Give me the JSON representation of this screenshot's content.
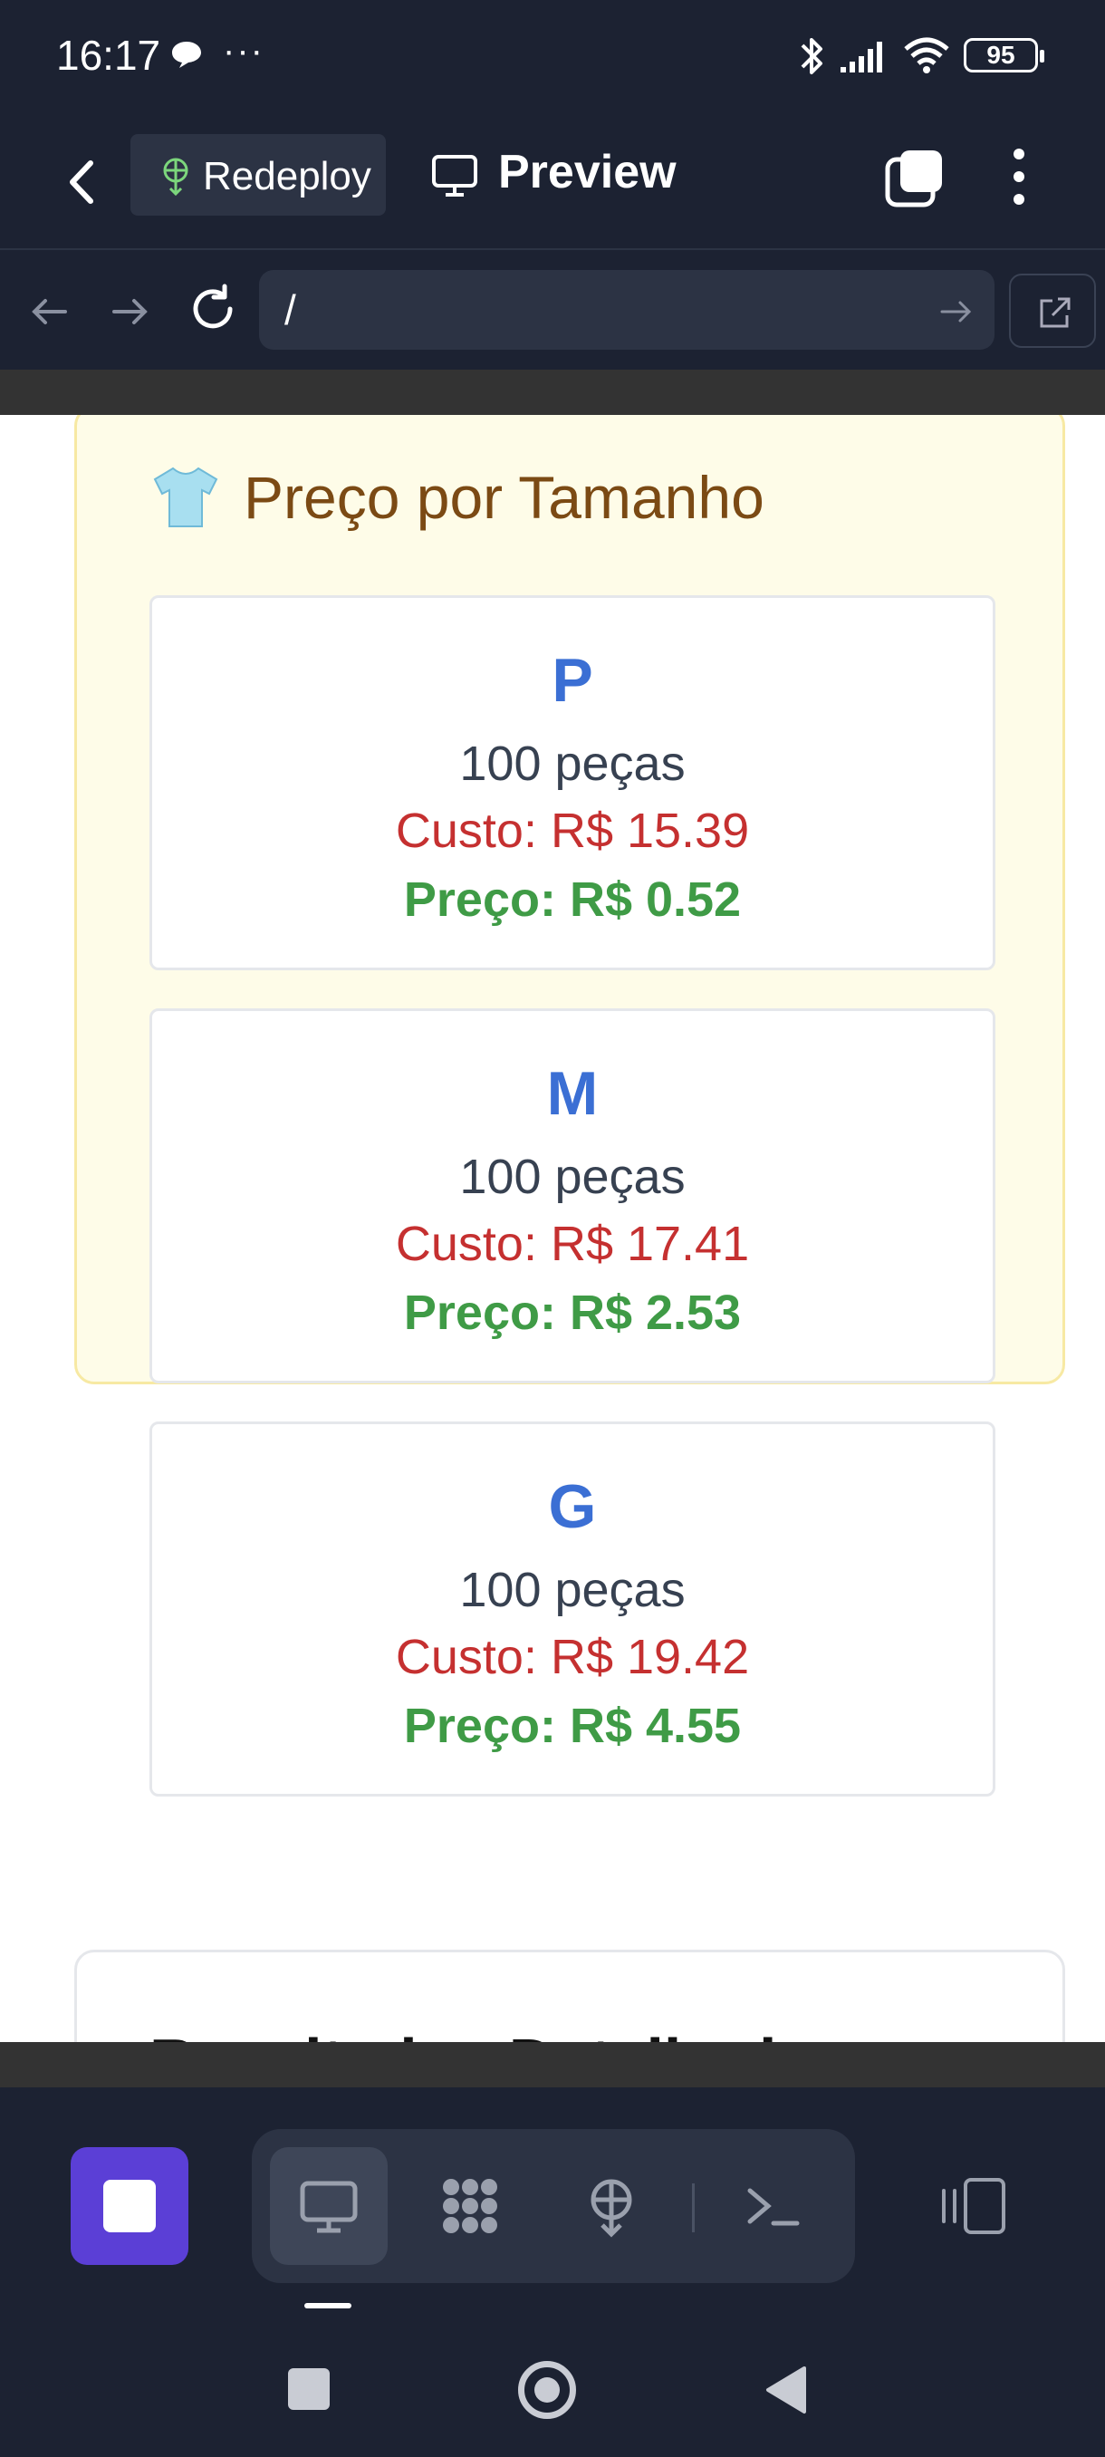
{
  "status_bar": {
    "time": "16:17",
    "dots": "···",
    "battery": "95"
  },
  "header": {
    "redeploy_label": "Redeploy",
    "preview_label": "Preview"
  },
  "url_bar": {
    "value": "/"
  },
  "pricing_card": {
    "title": "Preço por Tamanho",
    "sizes": [
      {
        "size": "P",
        "qty": "100 peças",
        "cost": "Custo: R$ 15.39",
        "price": "Preço: R$ 0.52"
      },
      {
        "size": "M",
        "qty": "100 peças",
        "cost": "Custo: R$ 17.41",
        "price": "Preço: R$ 2.53"
      },
      {
        "size": "G",
        "qty": "100 peças",
        "cost": "Custo: R$ 19.42",
        "price": "Preço: R$ 4.55"
      }
    ]
  },
  "next_card": {
    "title": "Resultados Detalhados"
  },
  "colors": {
    "background": "#1c2232",
    "accent": "#5b3fd6",
    "size_label": "#3b6fd4",
    "cost": "#c53030",
    "price": "#3f9b46",
    "card_title": "#7b4a14"
  }
}
